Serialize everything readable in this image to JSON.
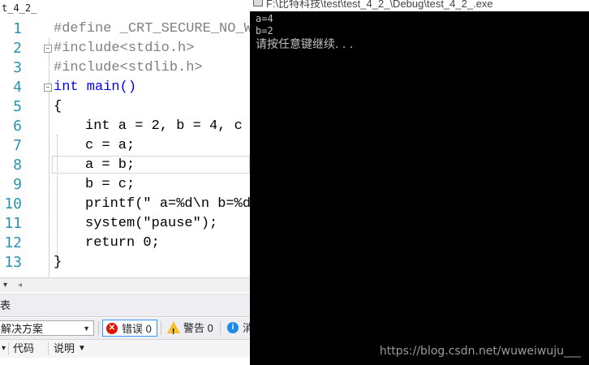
{
  "editor": {
    "file_tab": "t_4_2_",
    "lines": [
      {
        "num": "1",
        "text": "#define _CRT_SECURE_NO_W"
      },
      {
        "num": "2",
        "text": "#include<stdio.h>"
      },
      {
        "num": "3",
        "text": "#include<stdlib.h>"
      },
      {
        "num": "4",
        "text": "int main()"
      },
      {
        "num": "5",
        "text": "{"
      },
      {
        "num": "6",
        "text": "int a = 2, b = 4, c ="
      },
      {
        "num": "7",
        "text": "c = a;"
      },
      {
        "num": "8",
        "text": "a = b;"
      },
      {
        "num": "9",
        "text": "b = c;"
      },
      {
        "num": "10",
        "text": "printf(\" a=%d\\n b=%d"
      },
      {
        "num": "11",
        "text": "system(\"pause\");"
      },
      {
        "num": "12",
        "text": "return 0;"
      },
      {
        "num": "13",
        "text": "}"
      }
    ]
  },
  "error_panel": {
    "title": "表",
    "scope": "解决方案",
    "errors_label": "错误 0",
    "warnings_label": "警告 0",
    "messages_label": "消",
    "col_code": "代码",
    "col_desc": "说明"
  },
  "console": {
    "title": "F:\\比特科技\\test\\test_4_2_\\Debug\\test_4_2_.exe",
    "output": [
      "a=4",
      "b=2",
      "请按任意键继续. . ."
    ],
    "watermark": "https://blog.csdn.net/wuweiwuju___",
    "background": "#000000",
    "text_color": "#c0c0c0"
  },
  "colors": {
    "keyword": "#0000ff",
    "preprocessor": "#808080",
    "string": "#a31515",
    "line_number": "#2b91af"
  }
}
